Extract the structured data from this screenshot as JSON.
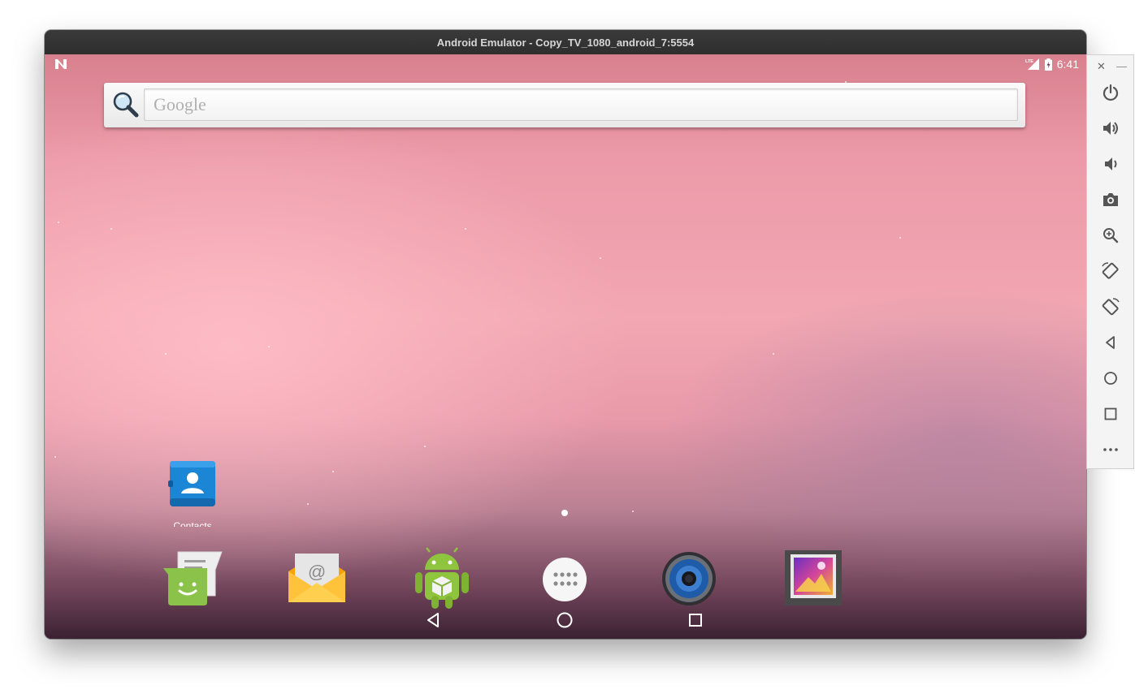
{
  "window": {
    "title": "Android Emulator - Copy_TV_1080_android_7:5554"
  },
  "status_bar": {
    "time": "6:41",
    "network": "LTE"
  },
  "search": {
    "placeholder": "Google"
  },
  "desktop": {
    "shortcuts": [
      {
        "label": "Contacts"
      }
    ]
  },
  "dock": {
    "apps": [
      "Messaging",
      "Email",
      "API Demos",
      "All apps",
      "Music",
      "Gallery"
    ]
  },
  "nav": [
    "back",
    "home",
    "recents"
  ],
  "side_panel": {
    "controls": [
      "power",
      "volume-up",
      "volume-down",
      "screenshot",
      "zoom",
      "rotate-left",
      "rotate-right",
      "back",
      "home",
      "overview",
      "more"
    ]
  },
  "colors": {
    "wallpaper_top": "#d8808e",
    "wallpaper_mid": "#f2a7b2",
    "wallpaper_bottom": "#3a2232",
    "titlebar": "#333333"
  }
}
